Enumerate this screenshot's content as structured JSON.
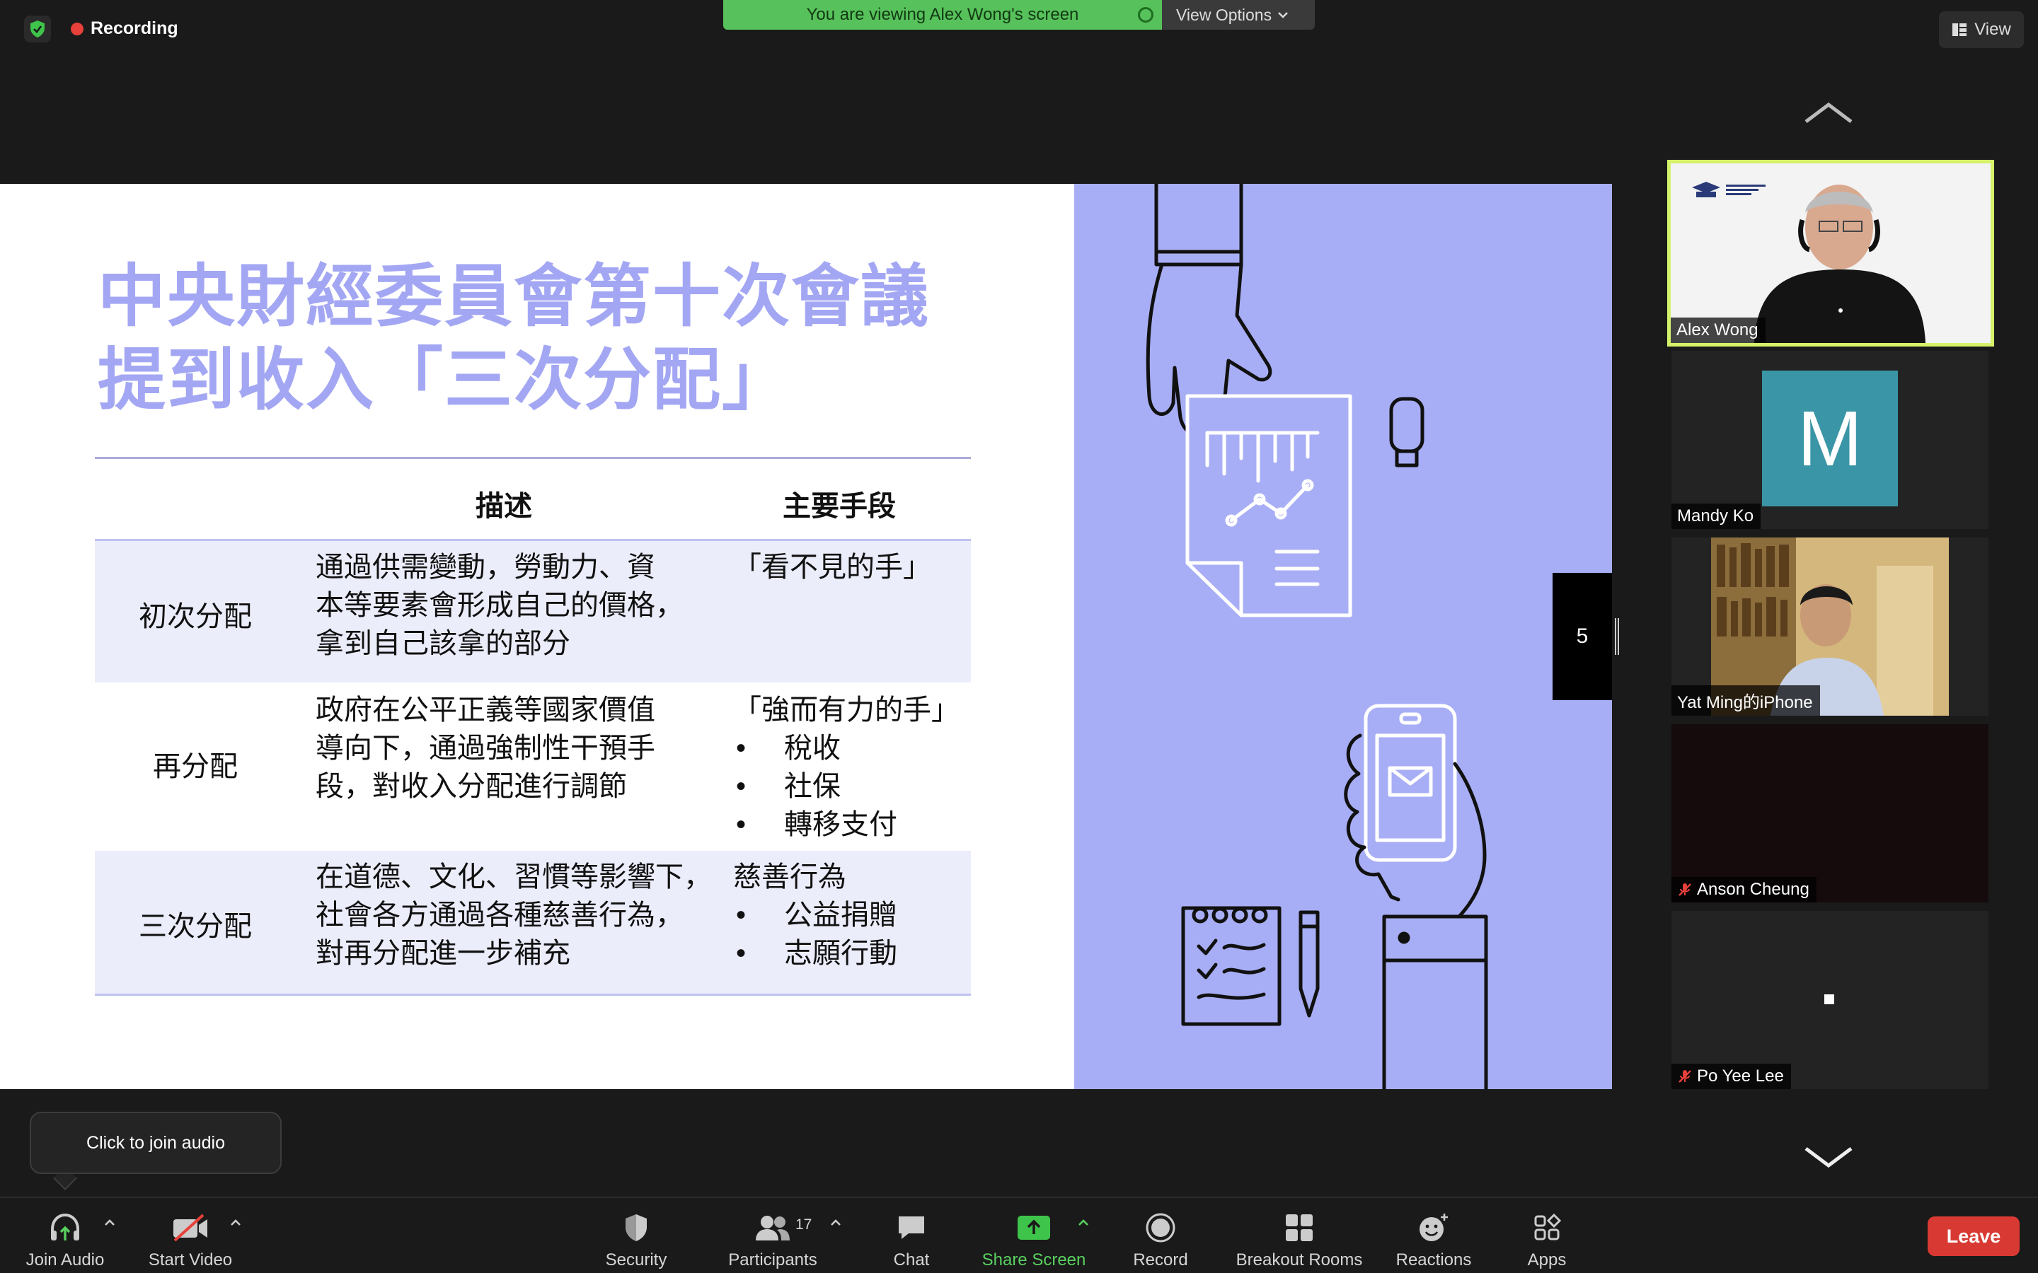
{
  "top": {
    "recording_label": "Recording",
    "viewing_banner": "You are viewing Alex Wong's screen",
    "view_options_label": "View Options",
    "view_label": "View"
  },
  "slide": {
    "title_line1": "中央財經委員會第十次會議",
    "title_line2": "提到收入「三次分配」",
    "headers": {
      "desc": "描述",
      "means": "主要手段"
    },
    "rows": [
      {
        "label": "初次分配",
        "desc": [
          "通過供需變動，勞動力、資",
          "本等要素會形成自己的價格，",
          "拿到自己該拿的部分"
        ],
        "means_title": "「看不見的手」",
        "bullets": []
      },
      {
        "label": "再分配",
        "desc": [
          "政府在公平正義等國家價值",
          "導向下，通過強制性干預手",
          "段，對收入分配進行調節"
        ],
        "means_title": "「強而有力的手」",
        "bullets": [
          "稅收",
          "社保",
          "轉移支付"
        ]
      },
      {
        "label": "三次分配",
        "desc": [
          "在道德、文化、習慣等影響下，",
          "社會各方通過各種慈善行為，",
          "對再分配進一步補充"
        ],
        "means_title": "慈善行為",
        "bullets": [
          "公益捐贈",
          "志願行動"
        ]
      }
    ],
    "bullet_symbol": "•",
    "page_number": "5",
    "colors": {
      "title": "#a3a7f3",
      "panel": "#a8aef5",
      "row_shade": "#ecedfb"
    }
  },
  "gallery": {
    "participants": [
      {
        "name": "Alex Wong",
        "muted": false,
        "active_speaker": true
      },
      {
        "name": "Mandy Ko",
        "muted": false,
        "avatar_letter": "M"
      },
      {
        "name": "Yat Ming的iPhone",
        "muted": false
      },
      {
        "name": "Anson Cheung",
        "muted": true
      },
      {
        "name": "Po Yee Lee",
        "muted": true
      }
    ]
  },
  "tooltip": {
    "text": "Click to join audio"
  },
  "toolbar": {
    "join_audio": "Join Audio",
    "start_video": "Start Video",
    "security": "Security",
    "participants": "Participants",
    "participants_count": "17",
    "chat": "Chat",
    "share_screen": "Share Screen",
    "record": "Record",
    "breakout_rooms": "Breakout Rooms",
    "reactions": "Reactions",
    "apps": "Apps",
    "leave": "Leave",
    "accent_green": "#5ad05f",
    "leave_color": "#d83a33"
  }
}
